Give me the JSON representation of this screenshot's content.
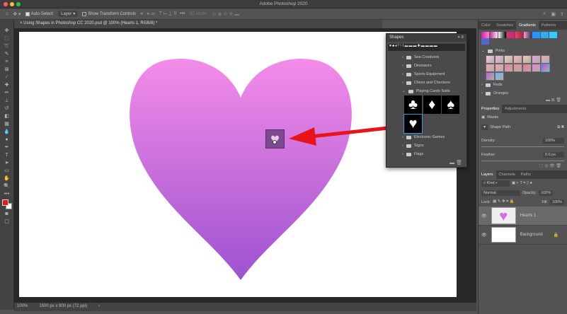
{
  "app": {
    "title": "Adobe Photoshop 2020"
  },
  "options": {
    "auto_select_label": "Auto-Select:",
    "auto_select_value": "Layer",
    "show_transform_label": "Show Transform Controls",
    "mode_3d": "3D Mode:"
  },
  "document": {
    "tab_title": "Using Shapes in Photoshop CC 2020.psd @ 100% (Hearts 1, RGB/8) *",
    "zoom": "100%",
    "dimensions": "1500 px x 900 px (72 ppi)"
  },
  "shapes_panel": {
    "title": "Shapes",
    "folders_before": [
      "Sea Creatures",
      "Dinosaurs",
      "Sports Equipment",
      "Chess and Checkers",
      "Playing Cards Suits"
    ],
    "suits": [
      "♣",
      "♦",
      "♠",
      "♥"
    ],
    "folders_after": [
      "Electronic Games",
      "Signs",
      "Flags"
    ]
  },
  "gradients_panel": {
    "tabs": [
      "Color",
      "Swatches",
      "Gradients",
      "Patterns"
    ],
    "active_tab": "Gradients",
    "folders": [
      "Pinks",
      "Reds",
      "Oranges"
    ],
    "pinks": [
      "#f7c6d9",
      "#f3b8d8",
      "#f9c9c0",
      "#f7b3b6",
      "#f9c7a8",
      "#e7a0d8",
      "#f0a9b8",
      "#f7a3b1",
      "#f6a0b0",
      "#f47a9a",
      "#f58c8c",
      "#f56f88",
      "#ef80c8",
      "#b056c8",
      "#c05ed6",
      "#6ab8e8"
    ]
  },
  "properties_panel": {
    "tabs": [
      "Properties",
      "Adjustments"
    ],
    "masks_label": "Masks",
    "shape_path_label": "Shape Path",
    "density_label": "Density:",
    "density_value": "100%",
    "feather_label": "Feather:",
    "feather_value": "0.0 px"
  },
  "layers_panel": {
    "tabs": [
      "Layers",
      "Channels",
      "Paths"
    ],
    "kind_label": "Kind",
    "blend_mode": "Normal",
    "opacity_label": "Opacity:",
    "opacity_value": "100%",
    "lock_label": "Lock:",
    "fill_label": "Fill:",
    "fill_value": "100%",
    "layers": [
      {
        "name": "Hearts 1"
      },
      {
        "name": "Background"
      }
    ]
  },
  "colors": {
    "heart_top": "#f48ce9",
    "heart_bottom": "#9d52cf",
    "arrow": "#e8141c",
    "foreground": "#e21a1a"
  }
}
